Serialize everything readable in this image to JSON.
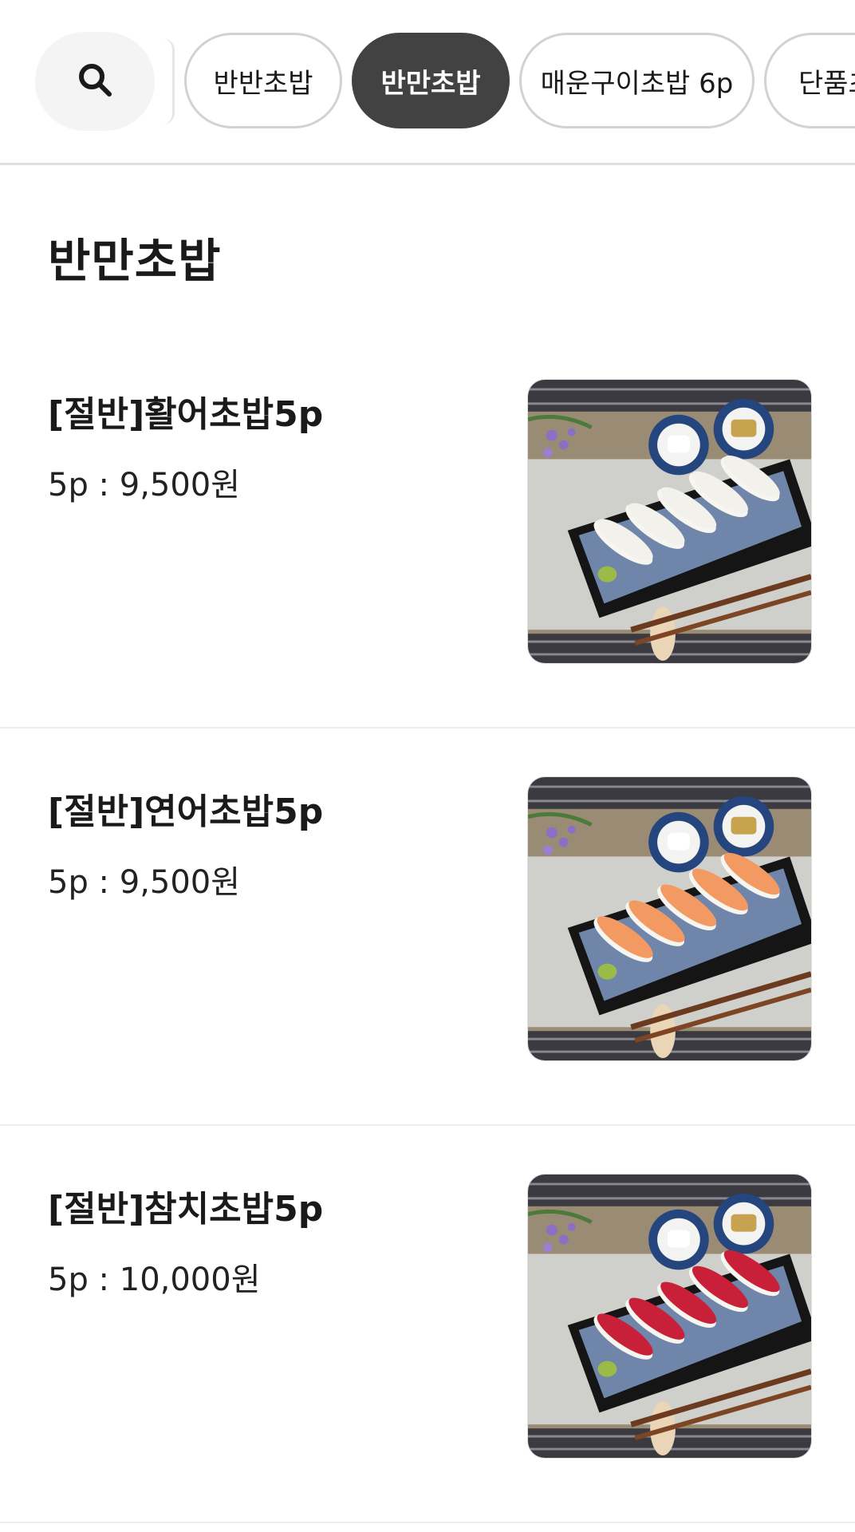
{
  "filter_bar": {
    "search_icon": "search-icon",
    "chips": [
      {
        "label": "반반초밥",
        "active": false
      },
      {
        "label": "반만초밥",
        "active": true
      },
      {
        "label": "매운구이초밥 6p",
        "active": false
      },
      {
        "label": "단품초",
        "active": false
      }
    ]
  },
  "section": {
    "title": "반만초밥"
  },
  "items": [
    {
      "name": "[절반]활어초밥5p",
      "price": "5p : 9,500원",
      "fish_color": "#f3f1ec"
    },
    {
      "name": "[절반]연어초밥5p",
      "price": "5p : 9,500원",
      "fish_color": "#f39a62"
    },
    {
      "name": "[절반]참치초밥5p",
      "price": "5p : 10,000원",
      "fish_color": "#c9203a"
    }
  ],
  "colors": {
    "active_chip": "#424242",
    "chip_border": "#d2d2d2",
    "divider": "#e0e0e0"
  }
}
